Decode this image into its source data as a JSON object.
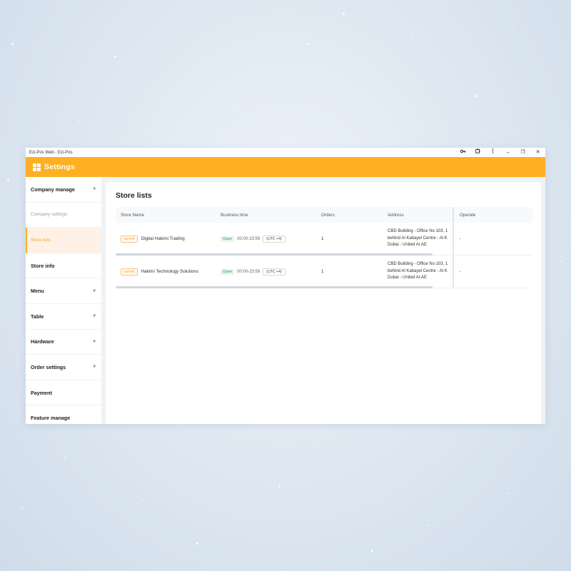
{
  "window": {
    "title": "Ezi-Pos Web - Ezi-Pos",
    "controls": {
      "key_icon": "key-icon",
      "extension_icon": "puzzle-icon",
      "more_icon": "more-vertical-icon",
      "minimize": "–",
      "restore": "❐",
      "close": "✕"
    }
  },
  "appbar": {
    "title": "Settings",
    "icon": "apps-grid-icon",
    "color": "#fdb022"
  },
  "sidebar": {
    "items": [
      {
        "label": "Company manage",
        "chevron": "˄"
      },
      {
        "label": "Company settings"
      },
      {
        "label": "Store lists"
      },
      {
        "label": "Store info"
      },
      {
        "label": "Menu",
        "chevron": "˅"
      },
      {
        "label": "Table",
        "chevron": "˅"
      },
      {
        "label": "Hardware",
        "chevron": "˅"
      },
      {
        "label": "Order settings",
        "chevron": "˅"
      },
      {
        "label": "Payment"
      },
      {
        "label": "Feature manage"
      }
    ]
  },
  "main": {
    "title": "Store lists",
    "table": {
      "headers": [
        "Store Name",
        "Business time",
        "Orders",
        "Address",
        "Operate"
      ],
      "rows": [
        {
          "tag": "current",
          "name": "Digital Hakimi Trading",
          "status": "Open",
          "hours": "00:00-23:59",
          "timezone": "(UTC +4)",
          "orders": "1",
          "address_lines": [
            "CBD Building - Office No 103, 1",
            "behind Al Kabayel Centre - Al K",
            "Dubai - United Ar.AE"
          ],
          "operate": "-"
        },
        {
          "tag": "current",
          "name": "Hakimi Technology Solutions",
          "status": "Open",
          "hours": "00:00-23:59",
          "timezone": "(UTC +4)",
          "orders": "1",
          "address_lines": [
            "CBD Building - Office No 103, 1",
            "behind Al Kabayel Centre - Al K",
            "Dubai - United Ar.AE"
          ],
          "operate": "-"
        }
      ]
    }
  }
}
